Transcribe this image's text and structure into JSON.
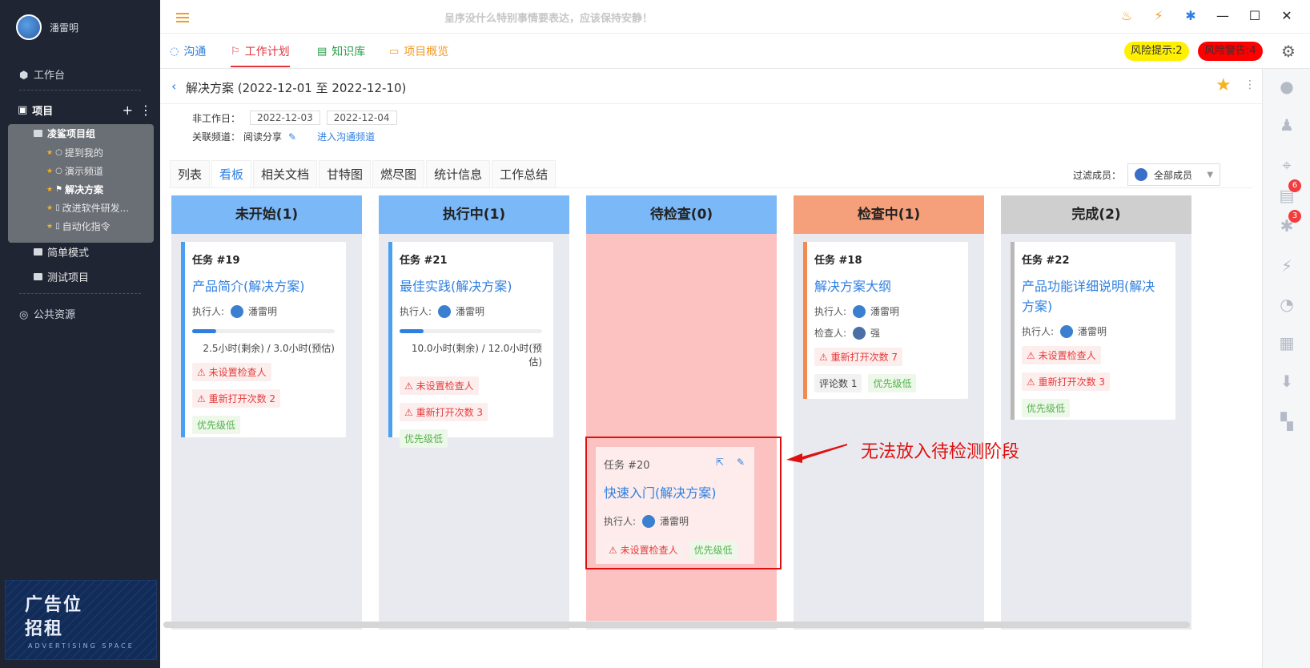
{
  "user": {
    "name": "潘雷明"
  },
  "sidebar": {
    "workbench": "工作台",
    "projects_label": "项目",
    "group_name": "凌鲨项目组",
    "group_items": [
      {
        "label": "提到我的",
        "icon": "chat-icon"
      },
      {
        "label": "演示频道",
        "icon": "chat-icon"
      },
      {
        "label": "解决方案",
        "icon": "flag-icon"
      },
      {
        "label": "改进软件研发...",
        "icon": "doc-icon"
      },
      {
        "label": "自动化指令",
        "icon": "doc-icon"
      }
    ],
    "other_projects": [
      "简单模式",
      "测试项目"
    ],
    "public": "公共资源",
    "ad": {
      "line1": "广告位",
      "line2": "招租",
      "line3": "ADVERTISING SPACE"
    }
  },
  "topbar": {
    "marquee": "呈序没什么特别事情要表达，应该保持安静！"
  },
  "nav": {
    "tabs": [
      {
        "label": "沟通",
        "color": "#2f7fe0",
        "icon": "chat-icon"
      },
      {
        "label": "工作计划",
        "color": "#e2343d",
        "icon": "flag-icon"
      },
      {
        "label": "知识库",
        "color": "#25a049",
        "icon": "book-icon"
      },
      {
        "label": "项目概览",
        "color": "#f59a23",
        "icon": "monitor-icon"
      }
    ],
    "risk_tip": "风险提示:2",
    "risk_warn": "风险警告:4"
  },
  "page": {
    "title": "解决方案 (2022-12-01 至 2022-12-10)",
    "nonwork_label": "非工作日：",
    "nonwork_dates": [
      "2022-12-03",
      "2022-12-04"
    ],
    "channel_label": "关联频道：",
    "channel_value": "阅读分享",
    "channel_link": "进入沟通频道",
    "tabs": [
      "列表",
      "看板",
      "相关文档",
      "甘特图",
      "燃尽图",
      "统计信息",
      "工作总结"
    ],
    "active_tab": "看板",
    "filter_label": "过滤成员：",
    "filter_value": "全部成员"
  },
  "kanban": {
    "columns": [
      {
        "title": "未开始(1)",
        "color": "#7bb8f8"
      },
      {
        "title": "执行中(1)",
        "color": "#7bb8f8"
      },
      {
        "title": "待检查(0)",
        "color": "#7bb8f8"
      },
      {
        "title": "检查中(1)",
        "color": "#f5a07a"
      },
      {
        "title": "完成(2)",
        "color": "#cfcfcf"
      }
    ],
    "cards": {
      "c19": {
        "id": "任务 #19",
        "title": "产品简介(解决方案)",
        "exec_label": "执行人:",
        "exec": "潘雷明",
        "progress": 0.17,
        "hours": "2.5小时(剩余) / 3.0小时(预估)",
        "tag1": "未设置检查人",
        "tag2": "重新打开次数 2",
        "tag3": "优先级低"
      },
      "c21": {
        "id": "任务 #21",
        "title": "最佳实践(解决方案)",
        "exec_label": "执行人:",
        "exec": "潘雷明",
        "progress": 0.17,
        "hours": "10.0小时(剩余) / 12.0小时(预估)",
        "tag1": "未设置检查人",
        "tag2": "重新打开次数 3",
        "tag3": "优先级低"
      },
      "c18": {
        "id": "任务 #18",
        "title": "解决方案大纲",
        "exec_label": "执行人:",
        "exec": "潘雷明",
        "check_label": "检查人:",
        "checker": "强",
        "tag1": "重新打开次数 7",
        "tag2": "评论数 1",
        "tag3": "优先级低"
      },
      "c22": {
        "id": "任务 #22",
        "title": "产品功能详细说明(解决方案)",
        "exec_label": "执行人:",
        "exec": "潘雷明",
        "tag1": "未设置检查人",
        "tag2": "重新打开次数 3",
        "tag3": "优先级低"
      },
      "c20": {
        "id": "任务 #20",
        "title": "快速入门(解决方案)",
        "exec_label": "执行人:",
        "exec": "潘雷明",
        "tag1": "未设置检查人",
        "tag2": "优先级低"
      }
    },
    "annotation": "无法放入待检测阶段"
  },
  "rail": {
    "badge1": "6",
    "badge2": "3"
  }
}
